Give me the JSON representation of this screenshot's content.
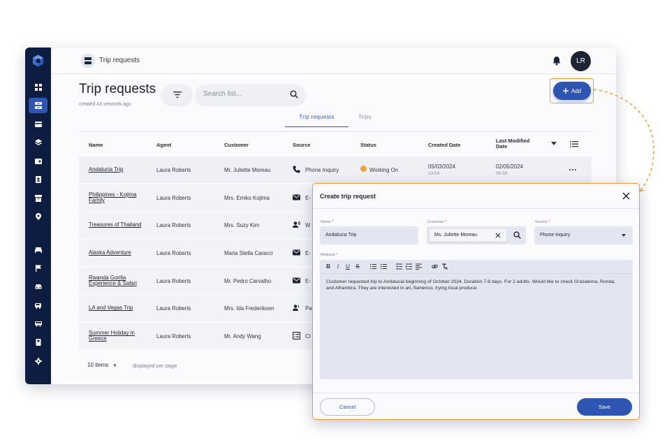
{
  "colors": {
    "sidebar": "#0d1d3f",
    "accent": "#2f55b3",
    "highlight": "#f29a2e",
    "status_working": "#f2a23a"
  },
  "sidebar": {
    "logo_icon": "cube-logo-icon",
    "items": [
      {
        "icon": "dashboard-icon",
        "active": false
      },
      {
        "icon": "trip-requests-icon",
        "active": true
      },
      {
        "icon": "card-icon",
        "active": false
      },
      {
        "icon": "layers-icon",
        "active": false
      },
      {
        "icon": "id-card-icon",
        "active": false
      },
      {
        "icon": "contacts-icon",
        "active": false
      },
      {
        "icon": "archive-icon",
        "active": false
      },
      {
        "icon": "location-icon",
        "active": false
      },
      {
        "icon": "bed-icon",
        "active": false
      },
      {
        "icon": "flag-icon",
        "active": false
      },
      {
        "icon": "car-icon",
        "active": false
      },
      {
        "icon": "shuttle-icon",
        "active": false
      },
      {
        "icon": "bus-icon",
        "active": false
      },
      {
        "icon": "book-icon",
        "active": false
      },
      {
        "icon": "settings-icon",
        "active": false
      }
    ]
  },
  "topbar": {
    "breadcrumb": "Trip requests",
    "avatar_initials": "LR"
  },
  "page": {
    "title": "Trip requests",
    "subtitle": "created 43 seconds ago",
    "search_placeholder": "Search list...",
    "add_label": "Add",
    "tabs": [
      "Trip requests",
      "Trips"
    ]
  },
  "table": {
    "columns": {
      "name": "Name",
      "agent": "Agent",
      "customer": "Customer",
      "source": "Source",
      "status": "Status",
      "created": "Created Date",
      "modified": "Last Modified Date"
    },
    "rows": [
      {
        "name": "Andalucia Trip",
        "agent": "Laura Roberts",
        "customer": "Mr. Juliette Moreau",
        "source": "Phone Inquiry",
        "source_icon": "phone-icon",
        "status": "Working On",
        "created_date": "05/03/2024",
        "created_time": "13:04",
        "modified_date": "02/05/2024",
        "modified_time": "09:28"
      },
      {
        "name": "Philippines - Kojima Family",
        "agent": "Laura Roberts",
        "customer": "Mrs. Emiko Kojima",
        "source": "E-",
        "source_icon": "mail-icon"
      },
      {
        "name": "Treasures of Thailand",
        "agent": "Laura Roberts",
        "customer": "Mrs. Suzy Kim",
        "source": "W",
        "source_icon": "people-icon"
      },
      {
        "name": "Alaska Adventure",
        "agent": "Laura Roberts",
        "customer": "Maria Stella Caracci",
        "source": "E-",
        "source_icon": "mail-icon"
      },
      {
        "name": "Rwanda Gorilla Experience & Safari",
        "agent": "Laura Roberts",
        "customer": "Mr. Pedro Carvalho",
        "source": "E-",
        "source_icon": "mail-icon"
      },
      {
        "name": "LA and Vegas Trip",
        "agent": "Laura Roberts",
        "customer": "Mrs. Ida Frederiksen",
        "source": "Pa",
        "source_icon": "people-icon"
      },
      {
        "name": "Summer Holiday in Greece",
        "agent": "Laura Roberts",
        "customer": "Mr. Andy Wang",
        "source": "Cl",
        "source_icon": "form-icon"
      }
    ]
  },
  "pager": {
    "per_page": "10 items",
    "note": "displayed per page"
  },
  "modal": {
    "title": "Create trip request",
    "name_label": "Name",
    "name_value": "Andalucia Trip",
    "customer_label": "Customer",
    "customer_value": "Ms. Juliette Moreau",
    "source_label": "Source",
    "source_value": "Phone Inquiry",
    "request_label": "Request",
    "required_mark": "*",
    "request_text": "Customer requested trip to Andalucia beginning of October 2024. Duration 7-8 days. For 2 adults. Would like to check Grazalema, Ronda, and Alhambra. They are interested in art, flamenco, trying local produce.",
    "toolbar": [
      "B",
      "I",
      "U",
      "S"
    ],
    "cancel_label": "Cancel",
    "save_label": "Save"
  }
}
